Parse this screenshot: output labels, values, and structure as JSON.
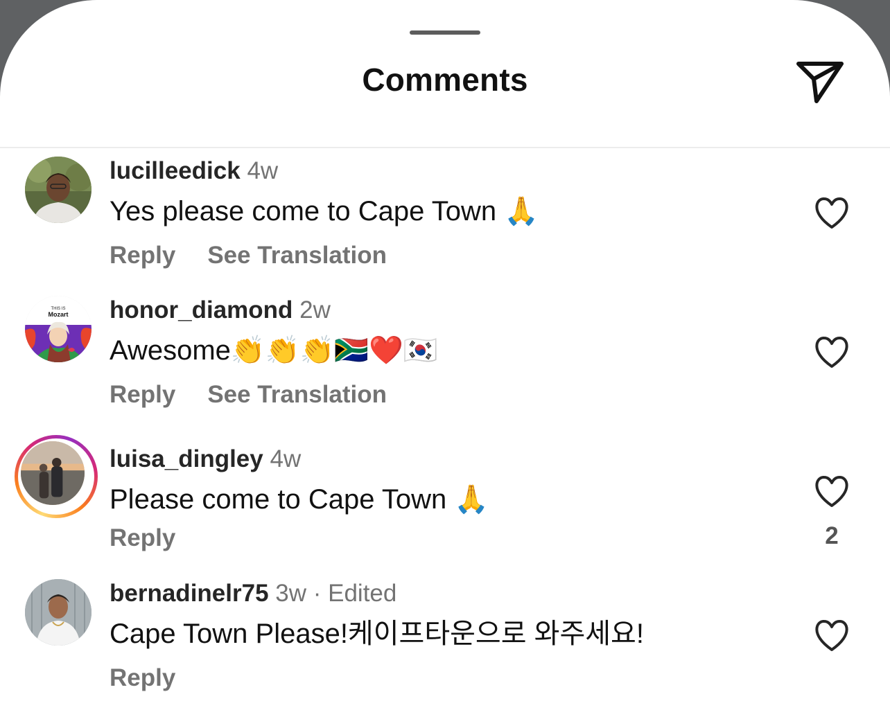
{
  "header": {
    "title": "Comments",
    "share_icon": "paper-plane-icon"
  },
  "comments": [
    {
      "username": "lucilleedick",
      "time": "4w",
      "text": "Yes please come to Cape Town 🙏",
      "actions": [
        "Reply",
        "See Translation"
      ],
      "likes": ""
    },
    {
      "username": "honor_diamond",
      "time": "2w",
      "text": "Awesome👏👏👏🇿🇦❤️🇰🇷",
      "actions": [
        "Reply",
        "See Translation"
      ],
      "likes": ""
    },
    {
      "username": "luisa_dingley",
      "time": "4w",
      "text": "Please come to Cape Town 🙏",
      "actions": [
        "Reply"
      ],
      "likes": "2"
    },
    {
      "username": "bernadinelr75",
      "time": "3w · Edited",
      "text": "Cape Town Please!케이프타운으로 와주세요!",
      "actions": [
        "Reply"
      ],
      "likes": ""
    }
  ],
  "colors": {
    "secondary_text": "#737373",
    "primary_text": "#111111",
    "divider": "#ececec"
  }
}
